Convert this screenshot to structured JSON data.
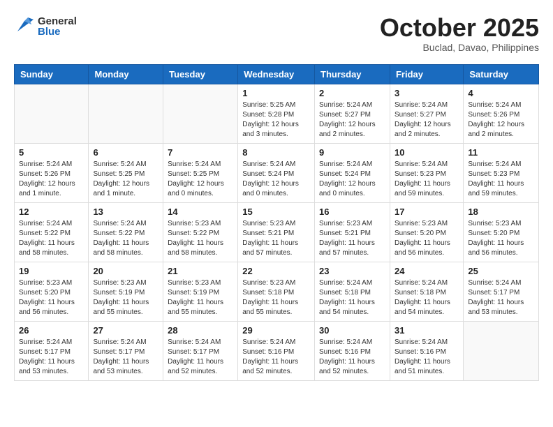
{
  "header": {
    "logo_general": "General",
    "logo_blue": "Blue",
    "month_title": "October 2025",
    "subtitle": "Buclad, Davao, Philippines"
  },
  "weekdays": [
    "Sunday",
    "Monday",
    "Tuesday",
    "Wednesday",
    "Thursday",
    "Friday",
    "Saturday"
  ],
  "weeks": [
    [
      {
        "day": "",
        "info": ""
      },
      {
        "day": "",
        "info": ""
      },
      {
        "day": "",
        "info": ""
      },
      {
        "day": "1",
        "info": "Sunrise: 5:25 AM\nSunset: 5:28 PM\nDaylight: 12 hours and 3 minutes."
      },
      {
        "day": "2",
        "info": "Sunrise: 5:24 AM\nSunset: 5:27 PM\nDaylight: 12 hours and 2 minutes."
      },
      {
        "day": "3",
        "info": "Sunrise: 5:24 AM\nSunset: 5:27 PM\nDaylight: 12 hours and 2 minutes."
      },
      {
        "day": "4",
        "info": "Sunrise: 5:24 AM\nSunset: 5:26 PM\nDaylight: 12 hours and 2 minutes."
      }
    ],
    [
      {
        "day": "5",
        "info": "Sunrise: 5:24 AM\nSunset: 5:26 PM\nDaylight: 12 hours and 1 minute."
      },
      {
        "day": "6",
        "info": "Sunrise: 5:24 AM\nSunset: 5:25 PM\nDaylight: 12 hours and 1 minute."
      },
      {
        "day": "7",
        "info": "Sunrise: 5:24 AM\nSunset: 5:25 PM\nDaylight: 12 hours and 0 minutes."
      },
      {
        "day": "8",
        "info": "Sunrise: 5:24 AM\nSunset: 5:24 PM\nDaylight: 12 hours and 0 minutes."
      },
      {
        "day": "9",
        "info": "Sunrise: 5:24 AM\nSunset: 5:24 PM\nDaylight: 12 hours and 0 minutes."
      },
      {
        "day": "10",
        "info": "Sunrise: 5:24 AM\nSunset: 5:23 PM\nDaylight: 11 hours and 59 minutes."
      },
      {
        "day": "11",
        "info": "Sunrise: 5:24 AM\nSunset: 5:23 PM\nDaylight: 11 hours and 59 minutes."
      }
    ],
    [
      {
        "day": "12",
        "info": "Sunrise: 5:24 AM\nSunset: 5:22 PM\nDaylight: 11 hours and 58 minutes."
      },
      {
        "day": "13",
        "info": "Sunrise: 5:24 AM\nSunset: 5:22 PM\nDaylight: 11 hours and 58 minutes."
      },
      {
        "day": "14",
        "info": "Sunrise: 5:23 AM\nSunset: 5:22 PM\nDaylight: 11 hours and 58 minutes."
      },
      {
        "day": "15",
        "info": "Sunrise: 5:23 AM\nSunset: 5:21 PM\nDaylight: 11 hours and 57 minutes."
      },
      {
        "day": "16",
        "info": "Sunrise: 5:23 AM\nSunset: 5:21 PM\nDaylight: 11 hours and 57 minutes."
      },
      {
        "day": "17",
        "info": "Sunrise: 5:23 AM\nSunset: 5:20 PM\nDaylight: 11 hours and 56 minutes."
      },
      {
        "day": "18",
        "info": "Sunrise: 5:23 AM\nSunset: 5:20 PM\nDaylight: 11 hours and 56 minutes."
      }
    ],
    [
      {
        "day": "19",
        "info": "Sunrise: 5:23 AM\nSunset: 5:20 PM\nDaylight: 11 hours and 56 minutes."
      },
      {
        "day": "20",
        "info": "Sunrise: 5:23 AM\nSunset: 5:19 PM\nDaylight: 11 hours and 55 minutes."
      },
      {
        "day": "21",
        "info": "Sunrise: 5:23 AM\nSunset: 5:19 PM\nDaylight: 11 hours and 55 minutes."
      },
      {
        "day": "22",
        "info": "Sunrise: 5:23 AM\nSunset: 5:18 PM\nDaylight: 11 hours and 55 minutes."
      },
      {
        "day": "23",
        "info": "Sunrise: 5:24 AM\nSunset: 5:18 PM\nDaylight: 11 hours and 54 minutes."
      },
      {
        "day": "24",
        "info": "Sunrise: 5:24 AM\nSunset: 5:18 PM\nDaylight: 11 hours and 54 minutes."
      },
      {
        "day": "25",
        "info": "Sunrise: 5:24 AM\nSunset: 5:17 PM\nDaylight: 11 hours and 53 minutes."
      }
    ],
    [
      {
        "day": "26",
        "info": "Sunrise: 5:24 AM\nSunset: 5:17 PM\nDaylight: 11 hours and 53 minutes."
      },
      {
        "day": "27",
        "info": "Sunrise: 5:24 AM\nSunset: 5:17 PM\nDaylight: 11 hours and 53 minutes."
      },
      {
        "day": "28",
        "info": "Sunrise: 5:24 AM\nSunset: 5:17 PM\nDaylight: 11 hours and 52 minutes."
      },
      {
        "day": "29",
        "info": "Sunrise: 5:24 AM\nSunset: 5:16 PM\nDaylight: 11 hours and 52 minutes."
      },
      {
        "day": "30",
        "info": "Sunrise: 5:24 AM\nSunset: 5:16 PM\nDaylight: 11 hours and 52 minutes."
      },
      {
        "day": "31",
        "info": "Sunrise: 5:24 AM\nSunset: 5:16 PM\nDaylight: 11 hours and 51 minutes."
      },
      {
        "day": "",
        "info": ""
      }
    ]
  ]
}
